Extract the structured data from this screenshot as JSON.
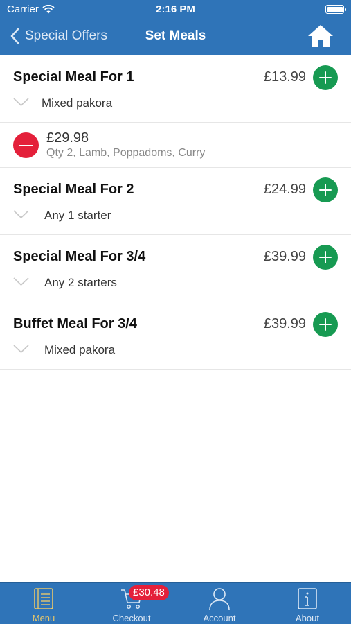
{
  "status_bar": {
    "carrier": "Carrier",
    "time": "2:16 PM"
  },
  "nav": {
    "back_label": "Special Offers",
    "title": "Set Meals"
  },
  "meals": [
    {
      "name": "Special Meal For 1",
      "price": "£13.99",
      "description": "Mixed pakora"
    },
    {
      "name": "Special Meal For 2",
      "price": "£24.99",
      "description": "Any 1 starter"
    },
    {
      "name": "Special Meal For 3/4",
      "price": "£39.99",
      "description": "Any 2 starters"
    },
    {
      "name": "Buffet Meal For 3/4",
      "price": "£39.99",
      "description": "Mixed pakora"
    }
  ],
  "cart_line": {
    "price": "£29.98",
    "detail": "Qty 2, Lamb, Poppadoms, Curry"
  },
  "tabs": [
    {
      "label": "Menu",
      "icon": "menu-book-icon",
      "active": true
    },
    {
      "label": "Checkout",
      "icon": "cart-icon",
      "active": false
    },
    {
      "label": "Account",
      "icon": "person-icon",
      "active": false
    },
    {
      "label": "About",
      "icon": "info-icon",
      "active": false
    }
  ],
  "cart_badge": "£30.48",
  "colors": {
    "brand_blue": "#2f74b8",
    "add_green": "#179a52",
    "remove_red": "#e4203a",
    "active_tab": "#e8c76a"
  }
}
